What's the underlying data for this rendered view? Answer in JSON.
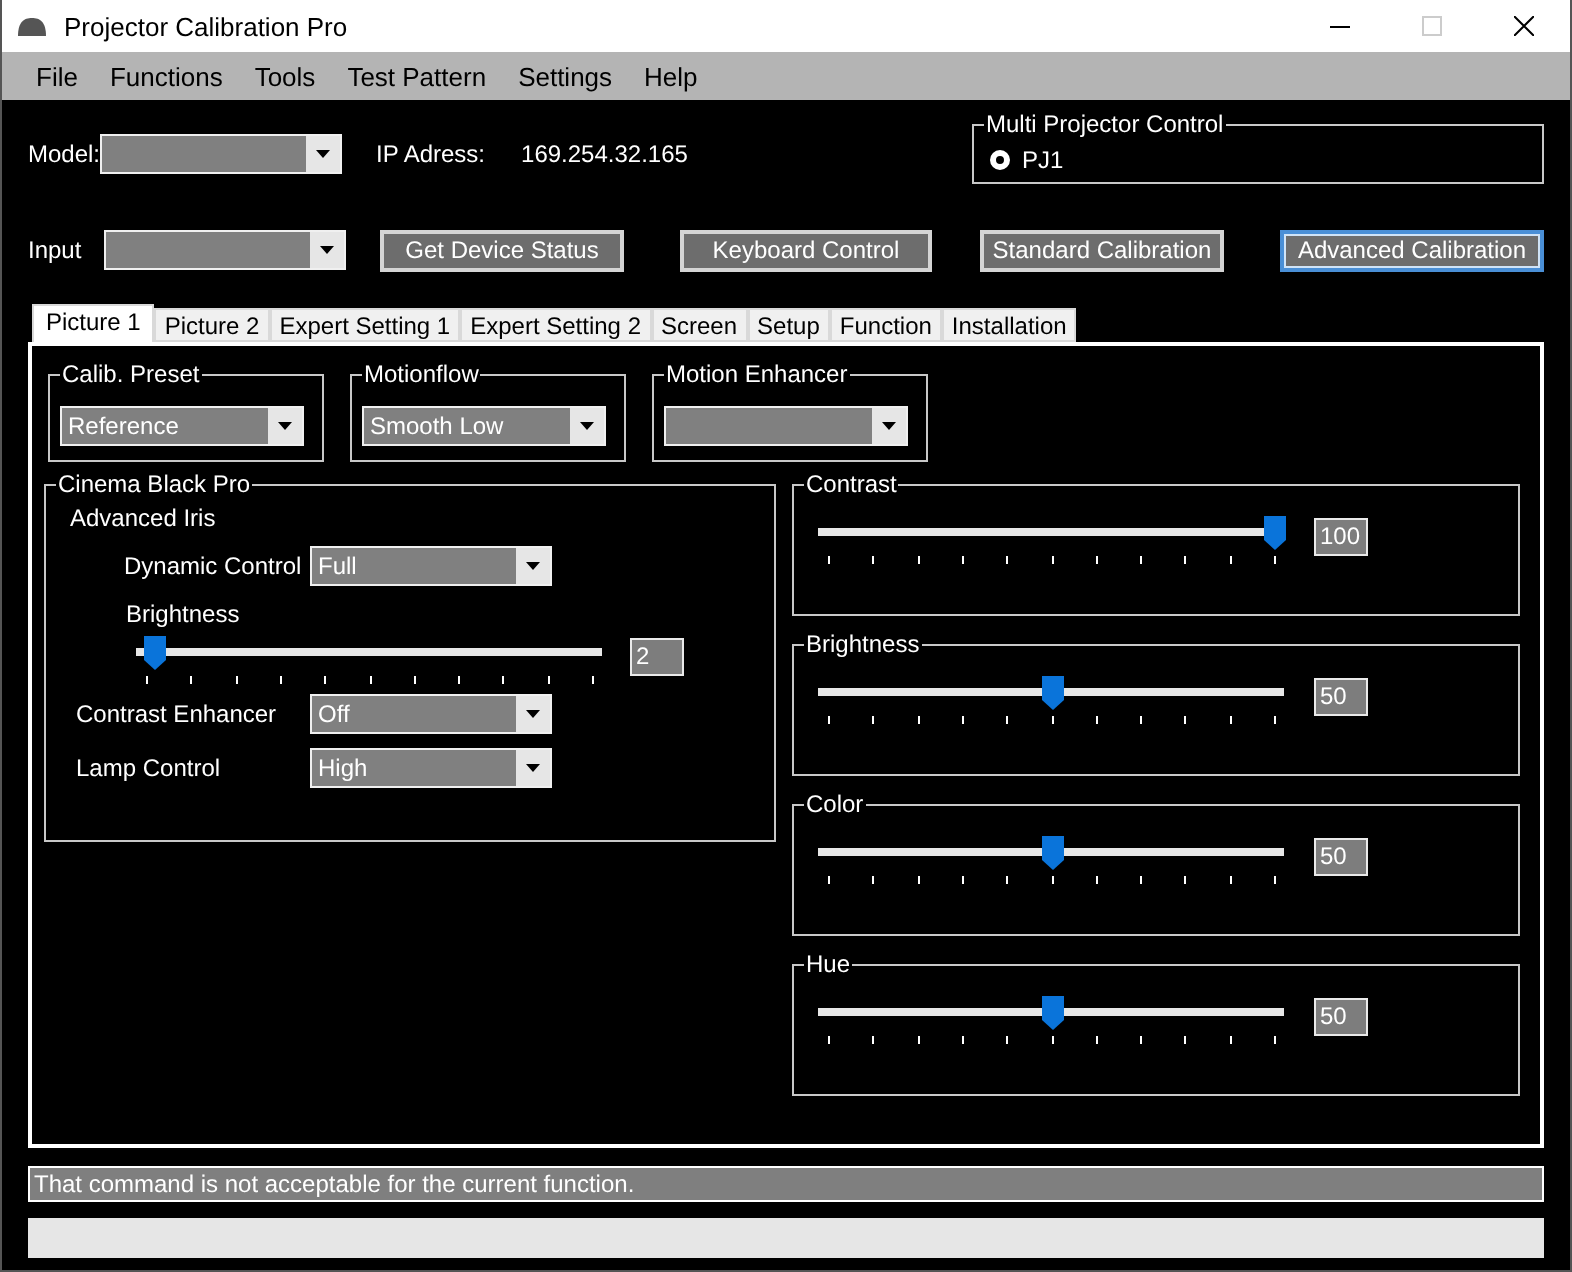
{
  "window": {
    "title": "Projector Calibration Pro"
  },
  "menu": [
    "File",
    "Functions",
    "Tools",
    "Test Pattern",
    "Settings",
    "Help"
  ],
  "model": {
    "label": "Model:"
  },
  "ip": {
    "label": "IP Adress:",
    "value": "169.254.32.165"
  },
  "multi_projector": {
    "title": "Multi Projector Control",
    "options": [
      {
        "label": "PJ1",
        "selected": true
      }
    ]
  },
  "input": {
    "label": "Input"
  },
  "buttons": [
    {
      "label": "Get Device Status",
      "focused": false
    },
    {
      "label": "Keyboard Control",
      "focused": false
    },
    {
      "label": "Standard Calibration",
      "focused": false
    },
    {
      "label": "Advanced Calibration",
      "focused": true
    }
  ],
  "tabs": [
    {
      "label": "Picture 1",
      "selected": true
    },
    {
      "label": "Picture 2",
      "selected": false
    },
    {
      "label": "Expert Setting 1",
      "selected": false
    },
    {
      "label": "Expert Setting 2",
      "selected": false
    },
    {
      "label": "Screen",
      "selected": false
    },
    {
      "label": "Setup",
      "selected": false
    },
    {
      "label": "Function",
      "selected": false
    },
    {
      "label": "Installation",
      "selected": false
    }
  ],
  "presets": [
    {
      "title": "Calib. Preset",
      "value": "Reference"
    },
    {
      "title": "Motionflow",
      "value": "Smooth Low"
    },
    {
      "title": "Motion Enhancer"
    }
  ],
  "cinema_black_pro": {
    "title": "Cinema Black Pro",
    "subtitle": "Advanced Iris",
    "dynamic_control": {
      "label": "Dynamic Control",
      "value": "Full"
    },
    "brightness": {
      "label": "Brightness",
      "level": 0.02,
      "reading": "2"
    },
    "contrast_enhancer": {
      "label": "Contrast Enhancer",
      "value": "Off"
    },
    "lamp_control": {
      "label": "Lamp Control",
      "value": "High"
    }
  },
  "sliders": [
    {
      "title": "Contrast",
      "level": 1,
      "reading": "100"
    },
    {
      "title": "Brightness",
      "level": 0.5,
      "reading": "50"
    },
    {
      "title": "Color",
      "level": 0.5,
      "reading": "50"
    },
    {
      "title": "Hue",
      "level": 0.5,
      "reading": "50"
    }
  ],
  "status_message": "That command is not acceptable for the current function.",
  "progress": {
    "level": 0
  }
}
